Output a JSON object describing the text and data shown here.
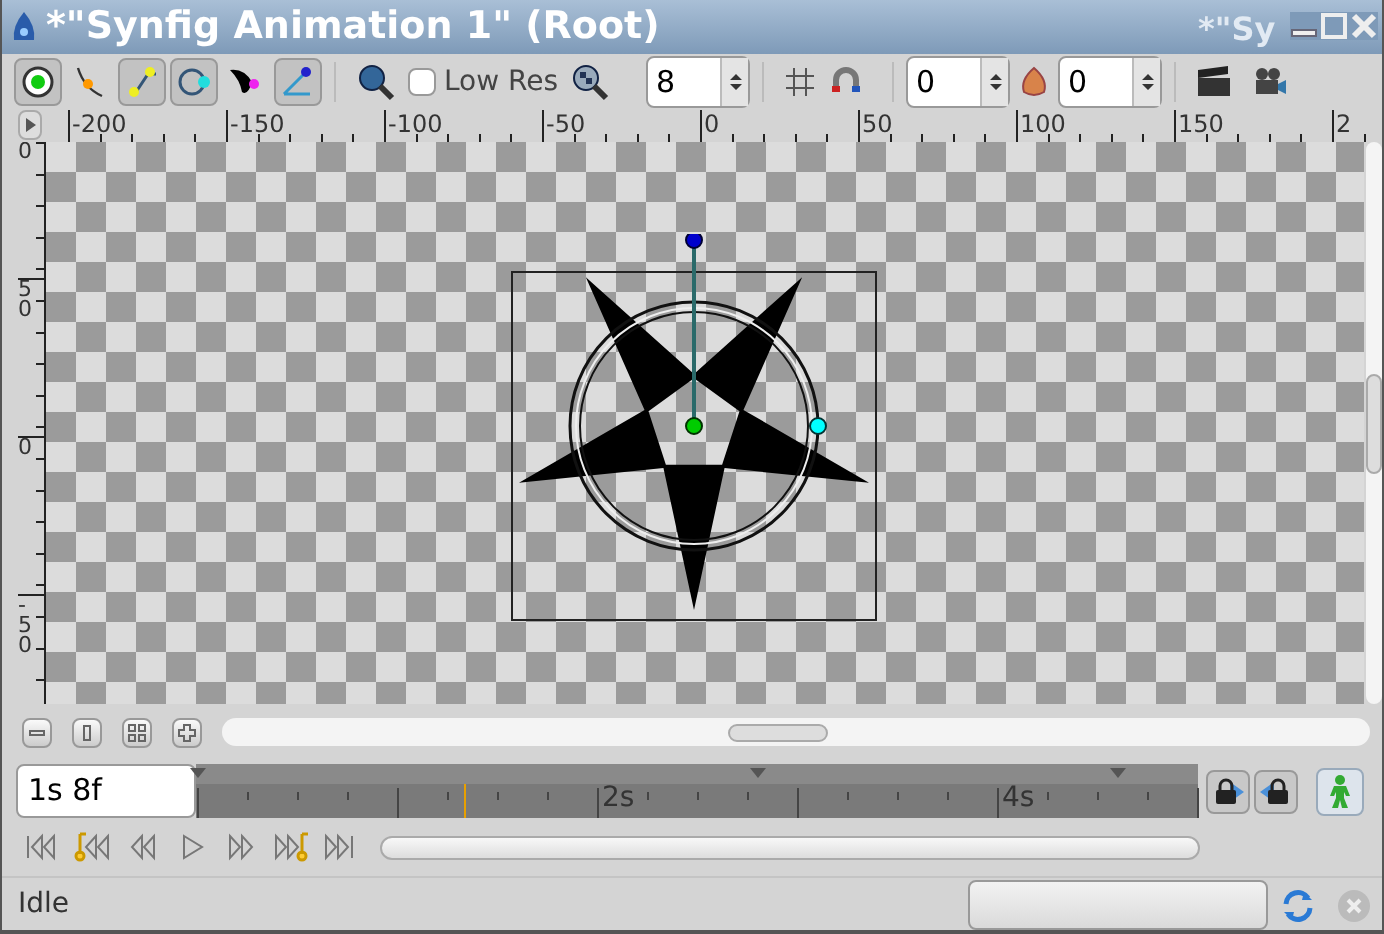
{
  "window": {
    "title": "*\"Synfig Animation 1\" (Root)",
    "background_window_title": "*\"Sy"
  },
  "toolbar": {
    "tools": [
      {
        "kind": "position",
        "selected": true
      },
      {
        "kind": "vertex",
        "selected": false
      },
      {
        "kind": "tangent",
        "selected": true
      },
      {
        "kind": "radius",
        "selected": true
      },
      {
        "kind": "width",
        "selected": false
      },
      {
        "kind": "angle",
        "selected": true
      }
    ],
    "low_res": {
      "label": "Low Res",
      "checked": false
    },
    "quality": "8",
    "onion_past": "0",
    "onion_future": "0"
  },
  "ruler": {
    "labels": [
      "-200",
      "-150",
      "-100",
      "-50",
      "0",
      "50",
      "100",
      "150",
      "2"
    ]
  },
  "vertical_ruler": {
    "labels": [
      "0",
      "50",
      "0",
      "-50"
    ]
  },
  "timebar": {
    "time": "1s 8f",
    "labels": [
      "2s",
      "4s"
    ],
    "time_cursor": {
      "level": 0.267
    }
  },
  "animate_mode": {
    "on": false
  },
  "progress": {
    "level": 0
  },
  "status_bar": {
    "text": "Idle"
  }
}
